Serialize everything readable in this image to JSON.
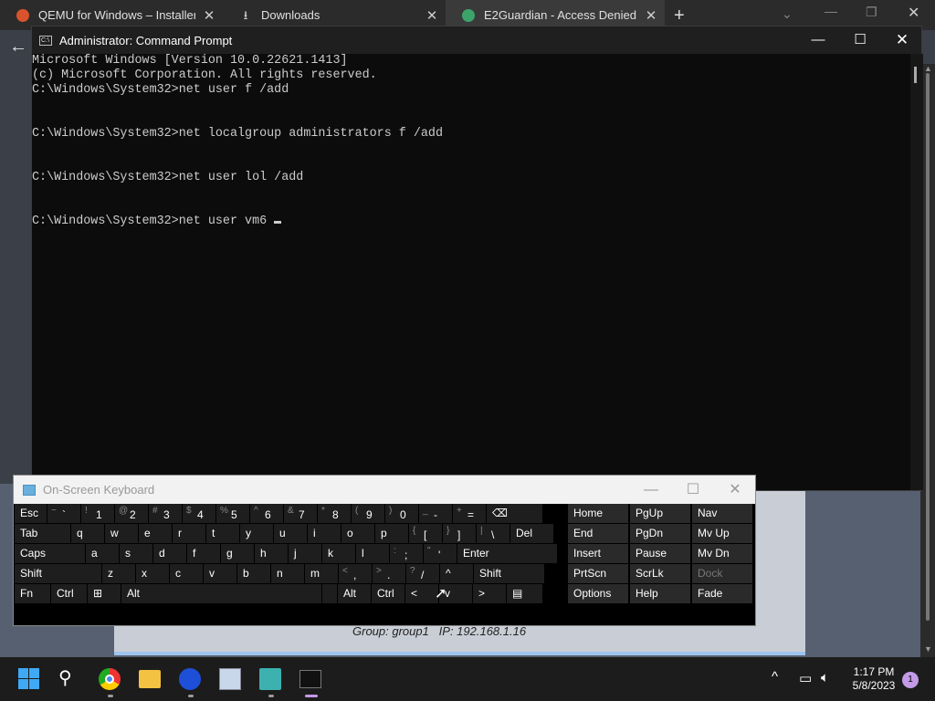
{
  "browser": {
    "tabs": [
      {
        "title": "QEMU for Windows – Installers (",
        "close": "✕"
      },
      {
        "title": "Downloads",
        "close": "✕"
      },
      {
        "title": "E2Guardian - Access Denied",
        "close": "✕"
      }
    ],
    "new_tab": "+",
    "page_info": "Group: group1   IP: 192.168.1.16"
  },
  "cmd": {
    "title": "Administrator: Command Prompt",
    "lines": [
      "Microsoft Windows [Version 10.0.22621.1413]",
      "(c) Microsoft Corporation. All rights reserved.",
      "",
      "C:\\Windows\\System32>net user f /add",
      "",
      "",
      "C:\\Windows\\System32>net localgroup administrators f /add",
      "",
      "",
      "C:\\Windows\\System32>net user lol /add",
      "",
      "",
      "C:\\Windows\\System32>net user vm6 "
    ]
  },
  "osk": {
    "title": "On-Screen Keyboard",
    "rows": [
      [
        {
          "l": "Esc"
        },
        {
          "s": "~",
          "m": "`"
        },
        {
          "s": "!",
          "m": "1"
        },
        {
          "s": "@",
          "m": "2"
        },
        {
          "s": "#",
          "m": "3"
        },
        {
          "s": "$",
          "m": "4"
        },
        {
          "s": "%",
          "m": "5"
        },
        {
          "s": "^",
          "m": "6"
        },
        {
          "s": "&",
          "m": "7"
        },
        {
          "s": "*",
          "m": "8"
        },
        {
          "s": "(",
          "m": "9"
        },
        {
          "s": ")",
          "m": "0"
        },
        {
          "s": "_",
          "m": "-"
        },
        {
          "s": "+",
          "m": "="
        },
        {
          "l": "⌫"
        }
      ],
      [
        {
          "l": "Tab"
        },
        {
          "l": "q"
        },
        {
          "l": "w"
        },
        {
          "l": "e"
        },
        {
          "l": "r"
        },
        {
          "l": "t"
        },
        {
          "l": "y"
        },
        {
          "l": "u"
        },
        {
          "l": "i"
        },
        {
          "l": "o"
        },
        {
          "l": "p"
        },
        {
          "s": "{",
          "m": "["
        },
        {
          "s": "}",
          "m": "]"
        },
        {
          "s": "|",
          "m": "\\"
        },
        {
          "l": "Del"
        }
      ],
      [
        {
          "l": "Caps"
        },
        {
          "l": "a"
        },
        {
          "l": "s"
        },
        {
          "l": "d"
        },
        {
          "l": "f"
        },
        {
          "l": "g"
        },
        {
          "l": "h"
        },
        {
          "l": "j"
        },
        {
          "l": "k"
        },
        {
          "l": "l"
        },
        {
          "s": ":",
          "m": ";"
        },
        {
          "s": "\"",
          "m": "'"
        },
        {
          "l": "Enter"
        }
      ],
      [
        {
          "l": "Shift"
        },
        {
          "l": "z"
        },
        {
          "l": "x"
        },
        {
          "l": "c"
        },
        {
          "l": "v"
        },
        {
          "l": "b"
        },
        {
          "l": "n"
        },
        {
          "l": "m"
        },
        {
          "s": "<",
          "m": ","
        },
        {
          "s": ">",
          "m": "."
        },
        {
          "s": "?",
          "m": "/"
        },
        {
          "l": "^"
        },
        {
          "l": "Shift"
        }
      ],
      [
        {
          "l": "Fn"
        },
        {
          "l": "Ctrl"
        },
        {
          "l": "⊞"
        },
        {
          "l": "Alt"
        },
        {
          "l": ""
        },
        {
          "l": "Alt"
        },
        {
          "l": "Ctrl"
        },
        {
          "l": "<"
        },
        {
          "l": "v"
        },
        {
          "l": ">"
        },
        {
          "l": "▤"
        }
      ]
    ],
    "nav": [
      [
        "Home",
        "PgUp",
        "Nav"
      ],
      [
        "End",
        "PgDn",
        "Mv Up"
      ],
      [
        "Insert",
        "Pause",
        "Mv Dn"
      ],
      [
        "PrtScn",
        "ScrLk",
        "Dock"
      ],
      [
        "Options",
        "Help",
        "Fade"
      ]
    ]
  },
  "taskbar": {
    "time": "1:17 PM",
    "date": "5/8/2023",
    "notifications": "1"
  }
}
